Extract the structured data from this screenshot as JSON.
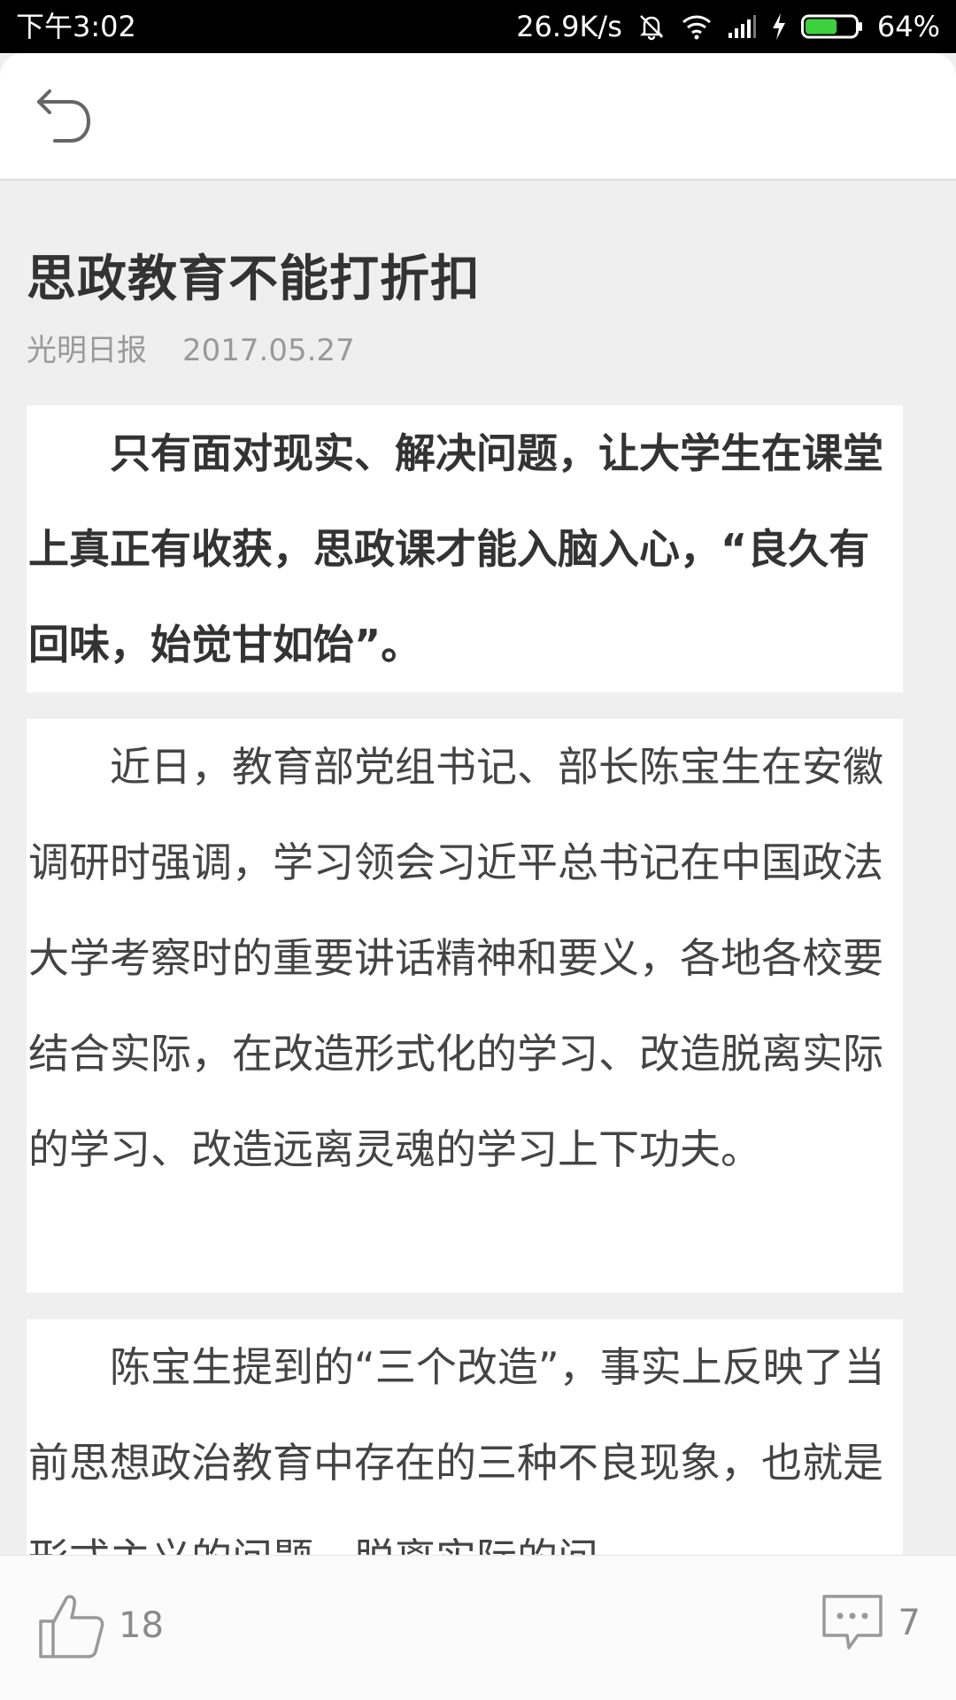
{
  "status_bar": {
    "time": "下午3:02",
    "speed": "26.9K/s",
    "battery": "64%",
    "battery_level": 0.64,
    "icons": [
      "mute-icon",
      "wifi-icon",
      "signal-icon",
      "charging-icon",
      "battery-icon"
    ]
  },
  "toolbar": {
    "back_icon": "back-arrow-icon"
  },
  "article": {
    "title": "思政教育不能打折扣",
    "source": "光明日报",
    "date": "2017.05.27",
    "paragraphs": [
      "只有面对现实、解决问题，让大学生在课堂上真正有收获，思政课才能入脑入心，“良久有回味，始觉甘如饴”。",
      "近日，教育部党组书记、部长陈宝生在安徽调研时强调，学习领会习近平总书记在中国政法大学考察时的重要讲话精神和要义，各地各校要结合实际，在改造形式化的学习、改造脱离实际的学习、改造远离灵魂的学习上下功夫。",
      "陈宝生提到的“三个改造”，事实上反映了当前思想政治教育中存在的三种不良现象，也就是形式主义的问题，脱离实际的问"
    ]
  },
  "actions": {
    "like_count": "18",
    "comment_count": "7",
    "like_icon": "thumbs-up-icon",
    "comment_icon": "comment-icon"
  },
  "colors": {
    "background": "#efefef",
    "status_bar": "#000000",
    "battery_fill": "#3dd13d",
    "text_primary": "#333333",
    "text_meta": "#9a9a9a"
  }
}
